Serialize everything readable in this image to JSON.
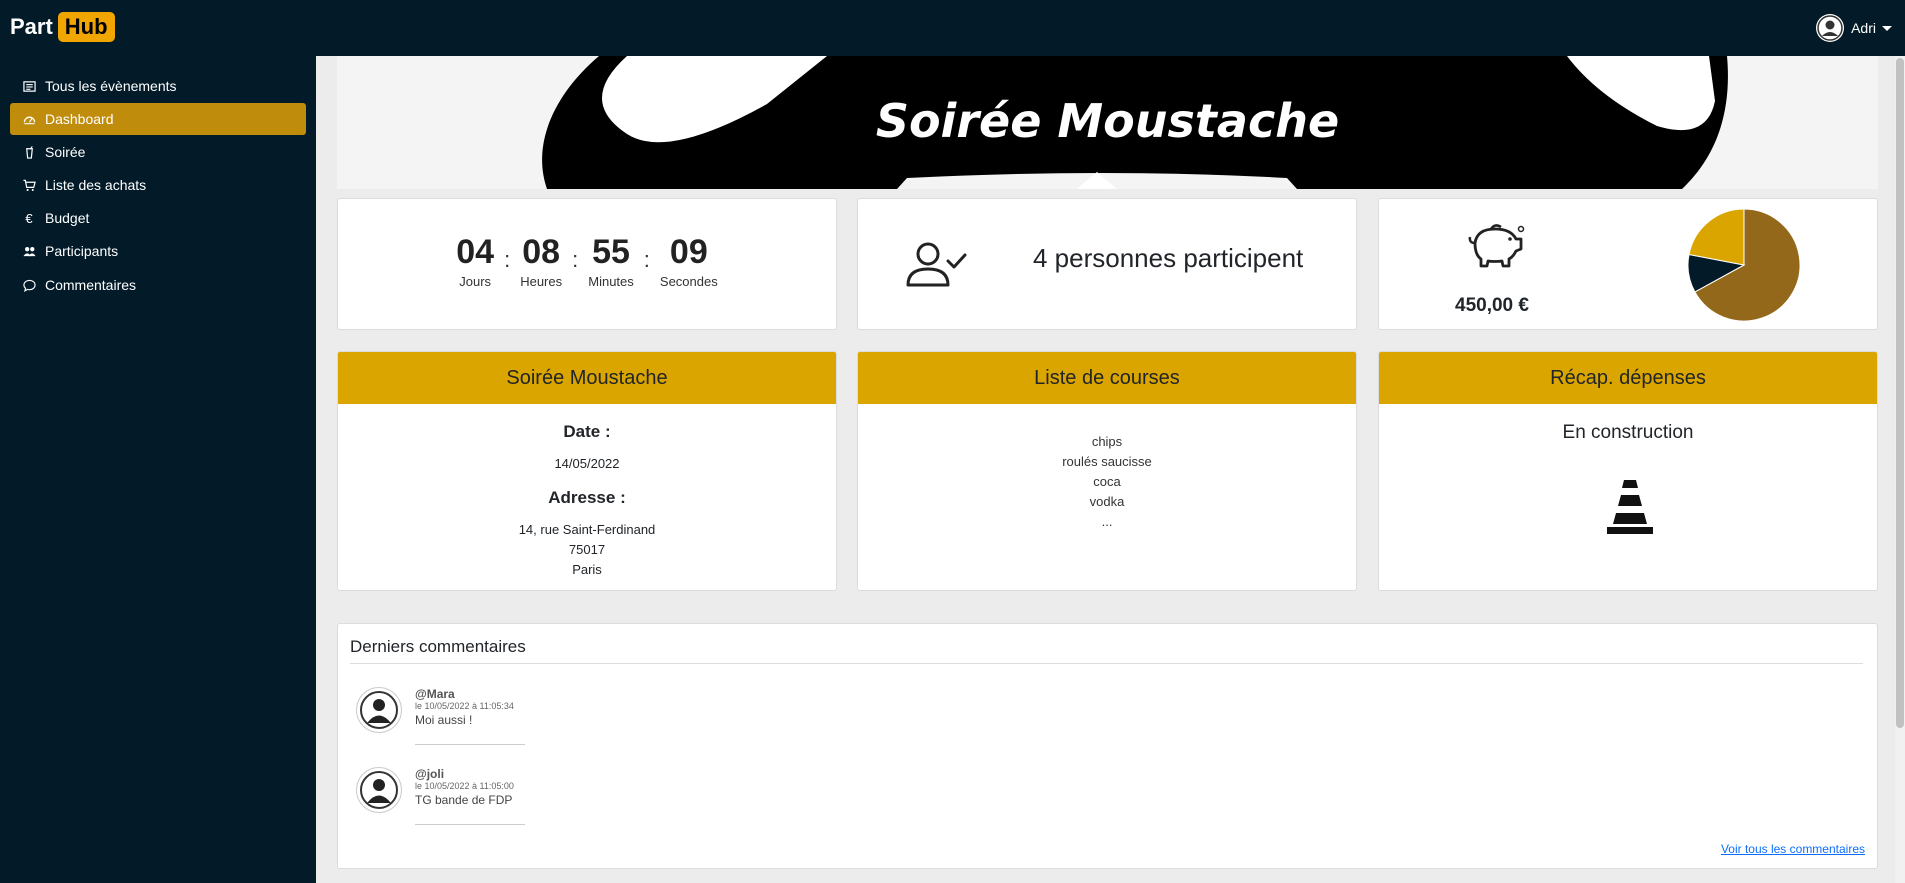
{
  "brand": {
    "part": "Part",
    "hub": "Hub"
  },
  "user": {
    "name": "Adri"
  },
  "sidebar": {
    "items": [
      {
        "label": "Tous les évènements",
        "icon": "list-icon"
      },
      {
        "label": "Dashboard",
        "icon": "dashboard-icon",
        "active": true
      },
      {
        "label": "Soirée",
        "icon": "glass-icon"
      },
      {
        "label": "Liste des achats",
        "icon": "cart-icon"
      },
      {
        "label": "Budget",
        "icon": "euro-icon"
      },
      {
        "label": "Participants",
        "icon": "people-icon"
      },
      {
        "label": "Commentaires",
        "icon": "chat-icon"
      }
    ]
  },
  "banner": {
    "title": "Soirée Moustache"
  },
  "countdown": {
    "days": "04",
    "days_label": "Jours",
    "hours": "08",
    "hours_label": "Heures",
    "minutes": "55",
    "minutes_label": "Minutes",
    "seconds": "09",
    "seconds_label": "Secondes",
    "separator": ":"
  },
  "participants": {
    "text": "4 personnes participent"
  },
  "budget": {
    "amount": "450,00 €",
    "pie": [
      {
        "value": 0.67,
        "color": "#94681a"
      },
      {
        "value": 0.11,
        "color": "#031b29"
      },
      {
        "value": 0.22,
        "color": "#dba500"
      }
    ]
  },
  "event_card": {
    "header": "Soirée Moustache",
    "date_label": "Date :",
    "date": "14/05/2022",
    "address_label": "Adresse :",
    "address_line1": "14, rue Saint-Ferdinand",
    "address_line2": "75017",
    "address_line3": "Paris"
  },
  "shopping_card": {
    "header": "Liste de courses",
    "items": [
      "chips",
      "roulés saucisse",
      "coca",
      "vodka",
      "..."
    ]
  },
  "expenses_card": {
    "header": "Récap. dépenses",
    "status": "En construction",
    "icon": "traffic-cone-icon"
  },
  "comments": {
    "title": "Derniers commentaires",
    "items": [
      {
        "author": "@Mara",
        "date": "le 10/05/2022 à 11:05:34",
        "text": "Moi aussi !"
      },
      {
        "author": "@joli",
        "date": "le 10/05/2022 à 11:05:00",
        "text": "TG bande de FDP"
      }
    ],
    "see_all": "Voir tous les commentaires"
  },
  "colors": {
    "nav": "#031b29",
    "accent": "#dba500",
    "active": "#bf8c0c"
  }
}
